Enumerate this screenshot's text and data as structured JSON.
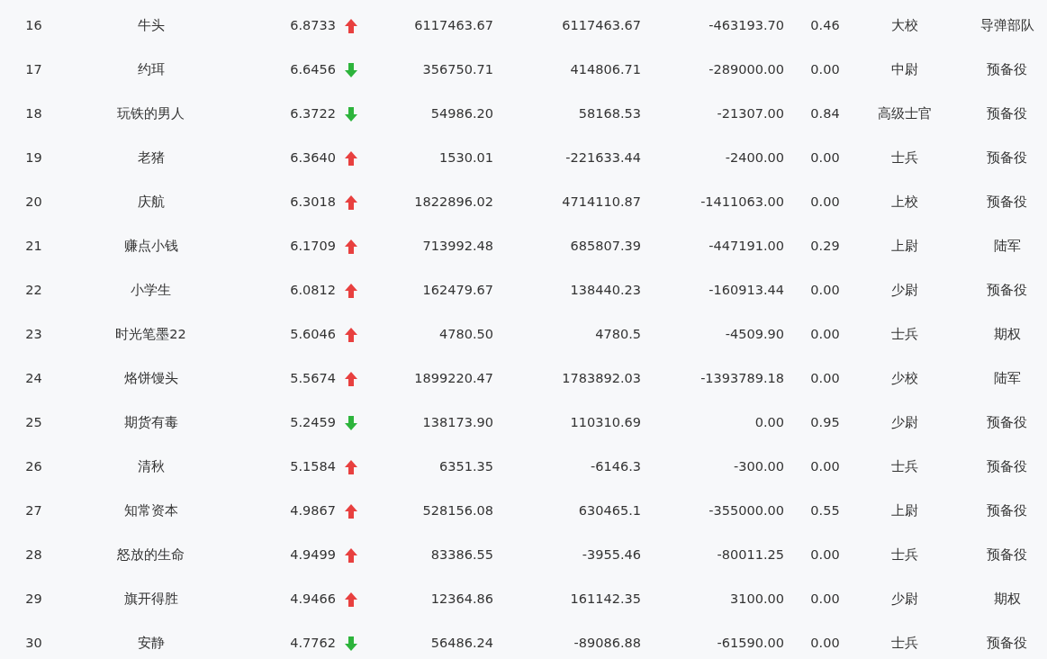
{
  "rows": [
    {
      "rank": "16",
      "name": "牛头",
      "value": "6.8733",
      "rising": true,
      "column_4": "6117463.67",
      "column_5": "6117463.67",
      "column_6": "-463193.70",
      "column_7": "0.46",
      "rank_title": "大校",
      "unit": "导弹部队"
    },
    {
      "rank": "17",
      "name": "约珥",
      "value": "6.6456",
      "rising": false,
      "column_4": "356750.71",
      "column_5": "414806.71",
      "column_6": "-289000.00",
      "column_7": "0.00",
      "rank_title": "中尉",
      "unit": "预备役"
    },
    {
      "rank": "18",
      "name": "玩铁的男人",
      "value": "6.3722",
      "rising": false,
      "column_4": "54986.20",
      "column_5": "58168.53",
      "column_6": "-21307.00",
      "column_7": "0.84",
      "rank_title": "高级士官",
      "unit": "预备役"
    },
    {
      "rank": "19",
      "name": "老猪",
      "value": "6.3640",
      "rising": true,
      "column_4": "1530.01",
      "column_5": "-221633.44",
      "column_6": "-2400.00",
      "column_7": "0.00",
      "rank_title": "士兵",
      "unit": "预备役"
    },
    {
      "rank": "20",
      "name": "庆航",
      "value": "6.3018",
      "rising": true,
      "column_4": "1822896.02",
      "column_5": "4714110.87",
      "column_6": "-1411063.00",
      "column_7": "0.00",
      "rank_title": "上校",
      "unit": "预备役"
    },
    {
      "rank": "21",
      "name": "赚点小钱",
      "value": "6.1709",
      "rising": true,
      "column_4": "713992.48",
      "column_5": "685807.39",
      "column_6": "-447191.00",
      "column_7": "0.29",
      "rank_title": "上尉",
      "unit": "陆军"
    },
    {
      "rank": "22",
      "name": "小学生",
      "value": "6.0812",
      "rising": true,
      "column_4": "162479.67",
      "column_5": "138440.23",
      "column_6": "-160913.44",
      "column_7": "0.00",
      "rank_title": "少尉",
      "unit": "预备役"
    },
    {
      "rank": "23",
      "name": "时光笔墨22",
      "value": "5.6046",
      "rising": true,
      "column_4": "4780.50",
      "column_5": "4780.5",
      "column_6": "-4509.90",
      "column_7": "0.00",
      "rank_title": "士兵",
      "unit": "期权"
    },
    {
      "rank": "24",
      "name": "烙饼馒头",
      "value": "5.5674",
      "rising": true,
      "column_4": "1899220.47",
      "column_5": "1783892.03",
      "column_6": "-1393789.18",
      "column_7": "0.00",
      "rank_title": "少校",
      "unit": "陆军"
    },
    {
      "rank": "25",
      "name": "期货有毒",
      "value": "5.2459",
      "rising": false,
      "column_4": "138173.90",
      "column_5": "110310.69",
      "column_6": "0.00",
      "column_7": "0.95",
      "rank_title": "少尉",
      "unit": "预备役"
    },
    {
      "rank": "26",
      "name": "清秋",
      "value": "5.1584",
      "rising": true,
      "column_4": "6351.35",
      "column_5": "-6146.3",
      "column_6": "-300.00",
      "column_7": "0.00",
      "rank_title": "士兵",
      "unit": "预备役"
    },
    {
      "rank": "27",
      "name": "知常资本",
      "value": "4.9867",
      "rising": true,
      "column_4": "528156.08",
      "column_5": "630465.1",
      "column_6": "-355000.00",
      "column_7": "0.55",
      "rank_title": "上尉",
      "unit": "预备役"
    },
    {
      "rank": "28",
      "name": "怒放的生命",
      "value": "4.9499",
      "rising": true,
      "column_4": "83386.55",
      "column_5": "-3955.46",
      "column_6": "-80011.25",
      "column_7": "0.00",
      "rank_title": "士兵",
      "unit": "预备役"
    },
    {
      "rank": "29",
      "name": "旗开得胜",
      "value": "4.9466",
      "rising": true,
      "column_4": "12364.86",
      "column_5": "161142.35",
      "column_6": "3100.00",
      "column_7": "0.00",
      "rank_title": "少尉",
      "unit": "期权"
    },
    {
      "rank": "30",
      "name": "安静",
      "value": "4.7762",
      "rising": false,
      "column_4": "56486.24",
      "column_5": "-89086.88",
      "column_6": "-61590.00",
      "column_7": "0.00",
      "rank_title": "士兵",
      "unit": "预备役"
    }
  ]
}
